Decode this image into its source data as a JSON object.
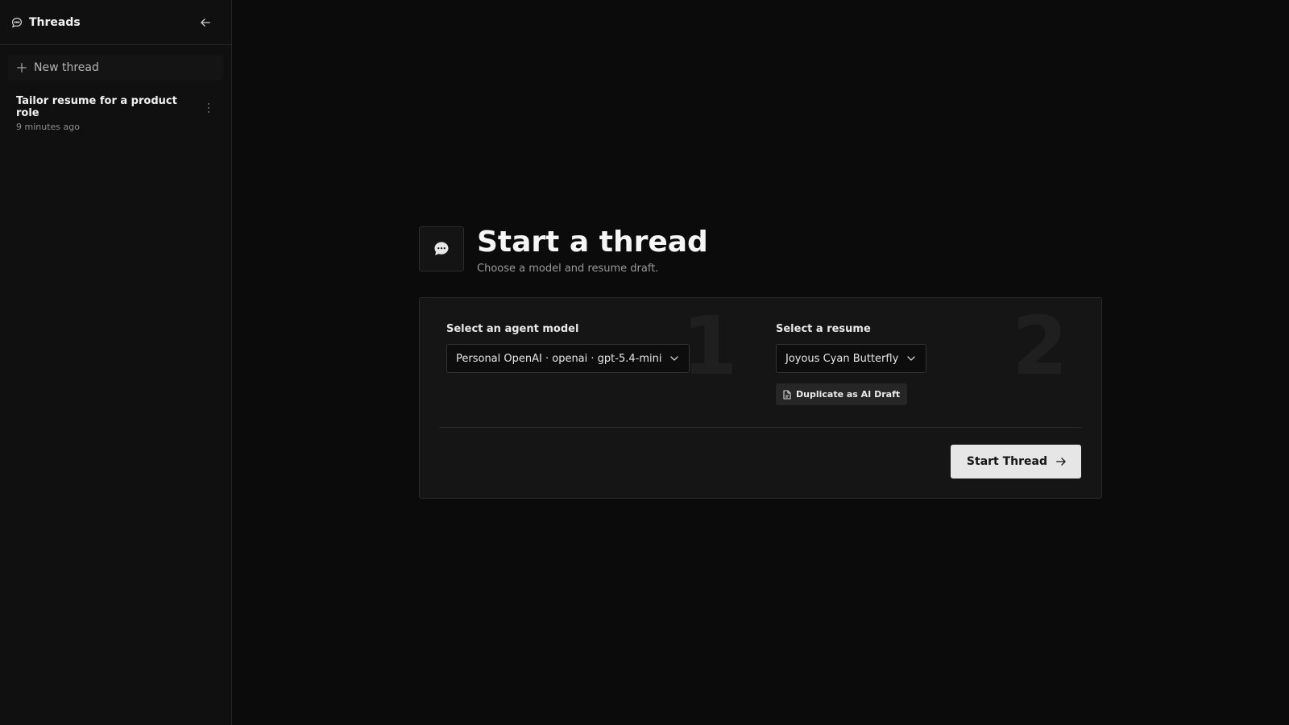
{
  "sidebar": {
    "title": "Threads",
    "new_thread_label": "New thread",
    "threads": [
      {
        "title": "Tailor resume for a product role",
        "time": "9 minutes ago"
      }
    ]
  },
  "main": {
    "title": "Start a thread",
    "subtitle": "Choose a model and resume draft.",
    "step1": {
      "number": "1",
      "label": "Select an agent model",
      "selected": "Personal OpenAI · openai · gpt-5.4-mini"
    },
    "step2": {
      "number": "2",
      "label": "Select a resume",
      "selected": "Joyous Cyan Butterfly",
      "duplicate_label": "Duplicate as AI Draft"
    },
    "start_label": "Start Thread"
  },
  "icons": {
    "sidebar": "chat-bubble-icon",
    "collapse": "arrow-left-icon",
    "new": "plus-icon",
    "menu": "more-vertical-icon",
    "hero": "chat-dots-icon",
    "dropdown": "chevron-down-icon",
    "file": "file-icon",
    "arrow": "arrow-right-icon"
  },
  "colors": {
    "background": "#0b0b0b",
    "sidebar": "#101010",
    "card": "#151515",
    "primary_button": "#e6e6e6"
  }
}
